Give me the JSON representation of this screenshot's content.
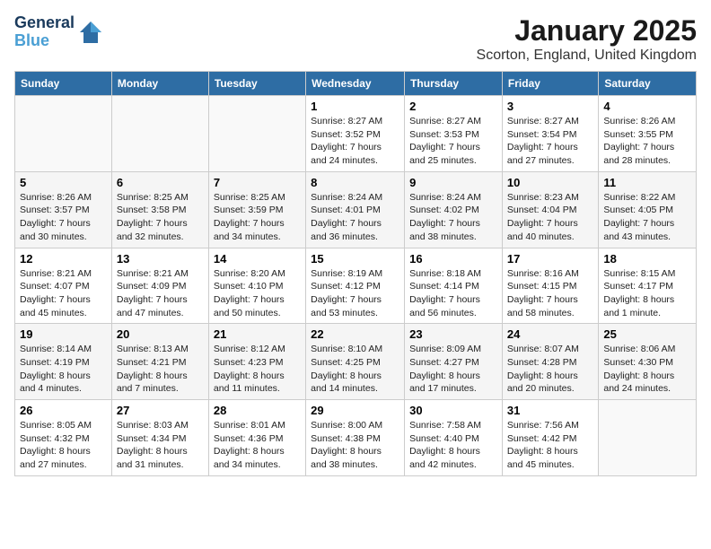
{
  "logo": {
    "line1": "General",
    "line2": "Blue"
  },
  "title": "January 2025",
  "subtitle": "Scorton, England, United Kingdom",
  "days_of_week": [
    "Sunday",
    "Monday",
    "Tuesday",
    "Wednesday",
    "Thursday",
    "Friday",
    "Saturday"
  ],
  "weeks": [
    [
      {
        "day": "",
        "info": ""
      },
      {
        "day": "",
        "info": ""
      },
      {
        "day": "",
        "info": ""
      },
      {
        "day": "1",
        "info": "Sunrise: 8:27 AM\nSunset: 3:52 PM\nDaylight: 7 hours and 24 minutes."
      },
      {
        "day": "2",
        "info": "Sunrise: 8:27 AM\nSunset: 3:53 PM\nDaylight: 7 hours and 25 minutes."
      },
      {
        "day": "3",
        "info": "Sunrise: 8:27 AM\nSunset: 3:54 PM\nDaylight: 7 hours and 27 minutes."
      },
      {
        "day": "4",
        "info": "Sunrise: 8:26 AM\nSunset: 3:55 PM\nDaylight: 7 hours and 28 minutes."
      }
    ],
    [
      {
        "day": "5",
        "info": "Sunrise: 8:26 AM\nSunset: 3:57 PM\nDaylight: 7 hours and 30 minutes."
      },
      {
        "day": "6",
        "info": "Sunrise: 8:25 AM\nSunset: 3:58 PM\nDaylight: 7 hours and 32 minutes."
      },
      {
        "day": "7",
        "info": "Sunrise: 8:25 AM\nSunset: 3:59 PM\nDaylight: 7 hours and 34 minutes."
      },
      {
        "day": "8",
        "info": "Sunrise: 8:24 AM\nSunset: 4:01 PM\nDaylight: 7 hours and 36 minutes."
      },
      {
        "day": "9",
        "info": "Sunrise: 8:24 AM\nSunset: 4:02 PM\nDaylight: 7 hours and 38 minutes."
      },
      {
        "day": "10",
        "info": "Sunrise: 8:23 AM\nSunset: 4:04 PM\nDaylight: 7 hours and 40 minutes."
      },
      {
        "day": "11",
        "info": "Sunrise: 8:22 AM\nSunset: 4:05 PM\nDaylight: 7 hours and 43 minutes."
      }
    ],
    [
      {
        "day": "12",
        "info": "Sunrise: 8:21 AM\nSunset: 4:07 PM\nDaylight: 7 hours and 45 minutes."
      },
      {
        "day": "13",
        "info": "Sunrise: 8:21 AM\nSunset: 4:09 PM\nDaylight: 7 hours and 47 minutes."
      },
      {
        "day": "14",
        "info": "Sunrise: 8:20 AM\nSunset: 4:10 PM\nDaylight: 7 hours and 50 minutes."
      },
      {
        "day": "15",
        "info": "Sunrise: 8:19 AM\nSunset: 4:12 PM\nDaylight: 7 hours and 53 minutes."
      },
      {
        "day": "16",
        "info": "Sunrise: 8:18 AM\nSunset: 4:14 PM\nDaylight: 7 hours and 56 minutes."
      },
      {
        "day": "17",
        "info": "Sunrise: 8:16 AM\nSunset: 4:15 PM\nDaylight: 7 hours and 58 minutes."
      },
      {
        "day": "18",
        "info": "Sunrise: 8:15 AM\nSunset: 4:17 PM\nDaylight: 8 hours and 1 minute."
      }
    ],
    [
      {
        "day": "19",
        "info": "Sunrise: 8:14 AM\nSunset: 4:19 PM\nDaylight: 8 hours and 4 minutes."
      },
      {
        "day": "20",
        "info": "Sunrise: 8:13 AM\nSunset: 4:21 PM\nDaylight: 8 hours and 7 minutes."
      },
      {
        "day": "21",
        "info": "Sunrise: 8:12 AM\nSunset: 4:23 PM\nDaylight: 8 hours and 11 minutes."
      },
      {
        "day": "22",
        "info": "Sunrise: 8:10 AM\nSunset: 4:25 PM\nDaylight: 8 hours and 14 minutes."
      },
      {
        "day": "23",
        "info": "Sunrise: 8:09 AM\nSunset: 4:27 PM\nDaylight: 8 hours and 17 minutes."
      },
      {
        "day": "24",
        "info": "Sunrise: 8:07 AM\nSunset: 4:28 PM\nDaylight: 8 hours and 20 minutes."
      },
      {
        "day": "25",
        "info": "Sunrise: 8:06 AM\nSunset: 4:30 PM\nDaylight: 8 hours and 24 minutes."
      }
    ],
    [
      {
        "day": "26",
        "info": "Sunrise: 8:05 AM\nSunset: 4:32 PM\nDaylight: 8 hours and 27 minutes."
      },
      {
        "day": "27",
        "info": "Sunrise: 8:03 AM\nSunset: 4:34 PM\nDaylight: 8 hours and 31 minutes."
      },
      {
        "day": "28",
        "info": "Sunrise: 8:01 AM\nSunset: 4:36 PM\nDaylight: 8 hours and 34 minutes."
      },
      {
        "day": "29",
        "info": "Sunrise: 8:00 AM\nSunset: 4:38 PM\nDaylight: 8 hours and 38 minutes."
      },
      {
        "day": "30",
        "info": "Sunrise: 7:58 AM\nSunset: 4:40 PM\nDaylight: 8 hours and 42 minutes."
      },
      {
        "day": "31",
        "info": "Sunrise: 7:56 AM\nSunset: 4:42 PM\nDaylight: 8 hours and 45 minutes."
      },
      {
        "day": "",
        "info": ""
      }
    ]
  ]
}
